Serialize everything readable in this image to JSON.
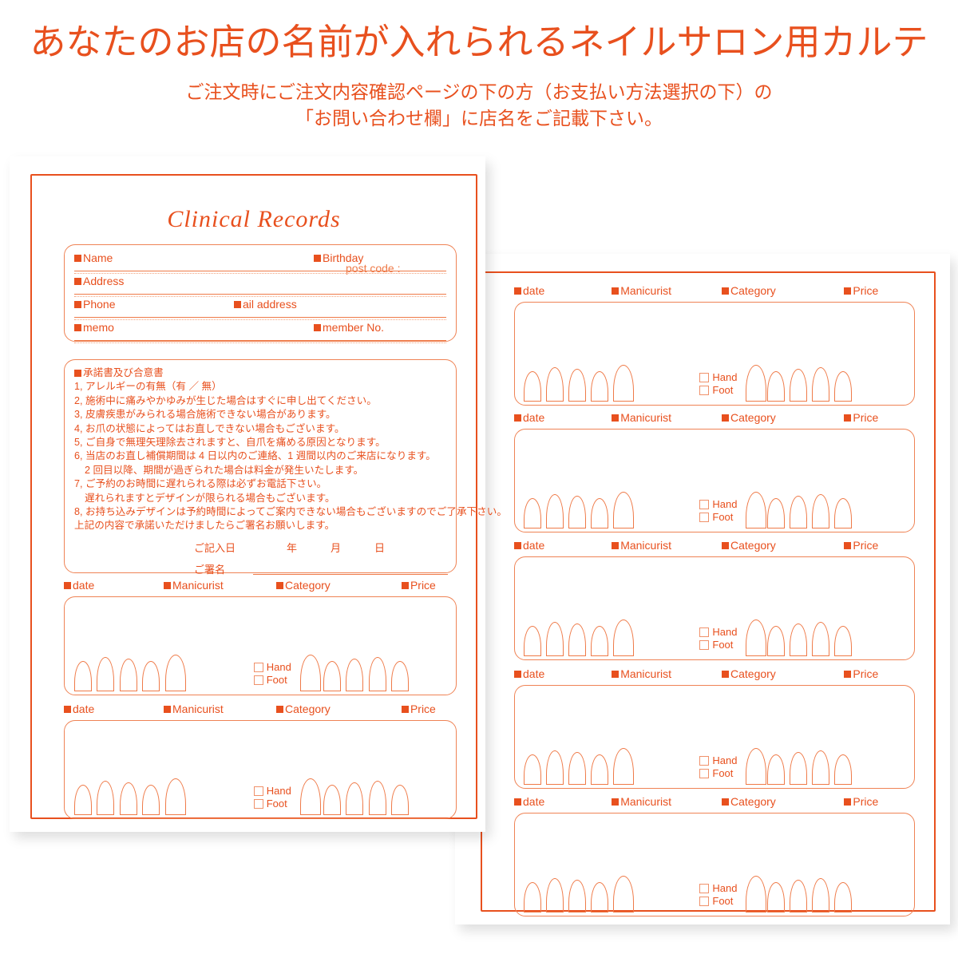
{
  "headings": {
    "main_title": "あなたのお店の名前が入れられるネイルサロン用カルテ",
    "subtitle_line1": "ご注文時にご注文内容確認ページの下の方（お支払い方法選択の下）の",
    "subtitle_line2": "「お問い合わせ欄」に店名をご記載下さい。"
  },
  "colors": {
    "accent": "#e8501e",
    "rule": "#ef7a48",
    "box_border": "#ef8355"
  },
  "record": {
    "title": "Clinical Records",
    "info_fields": {
      "name": "Name",
      "birthday": "Birthday",
      "address": "Address",
      "post_code": "post code :",
      "phone": "Phone",
      "mail_address": "ail address",
      "memo": "memo",
      "member_no": "member No."
    },
    "consent": {
      "heading": "承諾書及び合意書",
      "lines": [
        "1, アレルギーの有無（有 ／ 無）",
        "2, 施術中に痛みやかゆみが生じた場合はすぐに申し出てください。",
        "3, 皮膚疾患がみられる場合施術できない場合があります。",
        "4, お爪の状態によってはお直しできない場合もございます。",
        "5, ご自身で無理矢理除去されますと、自爪を痛める原因となります。",
        "6, 当店のお直し補償期間は 4 日以内のご連絡、1 週間以内のご来店になります。",
        "2 回目以降、期間が過ぎられた場合は料金が発生いたします。",
        "7, ご予約のお時間に遅れられる際は必ずお電話下さい。",
        "遅れられますとデザインが限られる場合もございます。",
        "8, お持ち込みデザインは予約時間によってご案内できない場合もございますのでご了承下さい。",
        "上記の内容で承諾いただけましたらご署名お願いします。"
      ],
      "indented": [
        false,
        false,
        false,
        false,
        false,
        false,
        true,
        false,
        true,
        false,
        false
      ],
      "entry_date_label": "ご記入日",
      "entry_date_year": "年",
      "entry_date_month": "月",
      "entry_date_day": "日",
      "signature_label": "ご署名"
    },
    "treatment_headers": {
      "date": "date",
      "manicurist": "Manicurist",
      "category": "Category",
      "price": "Price"
    },
    "treatment_options": {
      "hand": "Hand",
      "foot": "Foot"
    },
    "left_page_rows": 2,
    "right_page_rows": 5
  }
}
